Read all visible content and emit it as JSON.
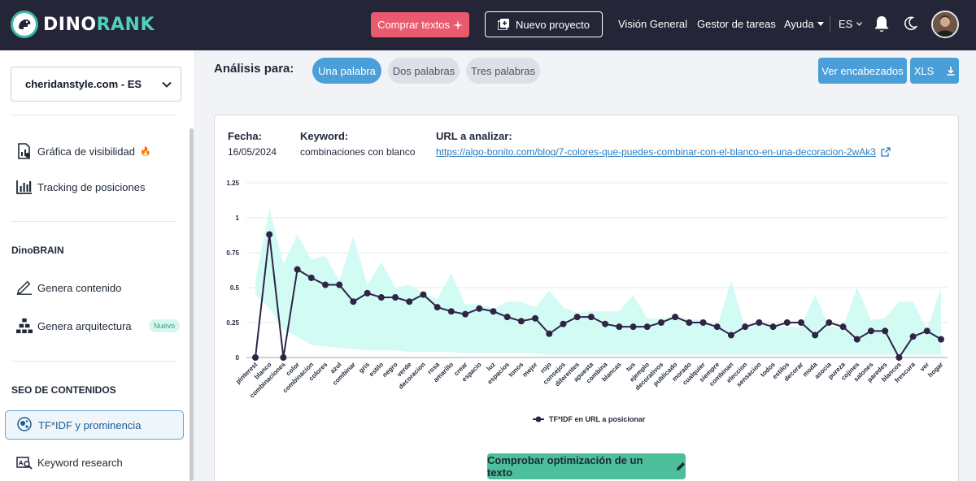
{
  "brand": {
    "name_part1": "DINO",
    "name_part2": "RANK",
    "color_primary": "#252538",
    "color_accent": "#4fd1b8"
  },
  "header": {
    "comprar_label": "Comprar textos",
    "nuevo_label": "Nuevo proyecto",
    "nav": [
      "Visión General",
      "Gestor de tareas",
      "Ayuda"
    ],
    "lang": "ES",
    "icons": [
      "bell-icon",
      "moon-icon",
      "avatar"
    ]
  },
  "sidebar": {
    "site": "cheridanstyle.com - ES",
    "items_top": [
      {
        "label": "Gráfica de visibilidad",
        "icon": "document-chart-icon",
        "emoji": "🔥"
      },
      {
        "label": "Tracking de posiciones",
        "icon": "bar-chart-icon"
      }
    ],
    "section_brain": "DinoBRAIN",
    "items_brain": [
      {
        "label": "Genera contenido",
        "icon": "pen-lines-icon"
      },
      {
        "label": "Genera arquitectura",
        "icon": "hierarchy-icon",
        "badge": "Nuevo"
      }
    ],
    "section_seo": "SEO DE CONTENIDOS",
    "items_seo": [
      {
        "label": "TF*IDF y prominencia",
        "icon": "bubbles-icon",
        "active": true
      },
      {
        "label": "Keyword research",
        "icon": "keyword-search-icon"
      }
    ]
  },
  "main": {
    "analisis_label": "Análisis para:",
    "tabs": [
      "Una palabra",
      "Dos palabras",
      "Tres palabras"
    ],
    "active_tab": "Una palabra",
    "btn_encabezados": "Ver encabezados",
    "btn_xls": "XLS",
    "fecha_label": "Fecha:",
    "fecha_value": "16/05/2024",
    "keyword_label": "Keyword:",
    "keyword_value": "combinaciones con blanco",
    "url_label": "URL a analizar:",
    "url_value": "https://algo-bonito.com/blog/7-colores-que-puedes-combinar-con-el-blanco-en-una-decoracion-2wAk3",
    "btn_comprobar": "Comprobar optimización de un texto"
  },
  "chart_data": {
    "type": "line",
    "ylim": [
      0,
      1.25
    ],
    "yticks": [
      "0",
      "0.25",
      "0.5",
      "0.75",
      "1",
      "1.25"
    ],
    "categories": [
      "pinterest",
      "blanco",
      "combinaciones",
      "color",
      "combinacion",
      "colores",
      "azul",
      "combinar",
      "gris",
      "estilo",
      "negro",
      "verde",
      "decoracion",
      "rosa",
      "amarillo",
      "crear",
      "espacio",
      "luz",
      "espacios",
      "tonos",
      "mejor",
      "rojo",
      "consejos",
      "diferentes",
      "apuesta",
      "combina",
      "blancas",
      "tus",
      "ejemplo",
      "decorativos",
      "publicado",
      "morado",
      "cualquier",
      "siempre",
      "combinan",
      "eleccion",
      "sensacion",
      "todos",
      "estilos",
      "decorar",
      "moda",
      "asocia",
      "pureza",
      "cojines",
      "salones",
      "paredes",
      "blancos",
      "frescura",
      "ver",
      "hogar"
    ],
    "series": [
      {
        "name": "TF*IDF en URL a posicionar",
        "color": "#2e2446",
        "values": [
          0,
          0.88,
          0,
          0.63,
          0.57,
          0.52,
          0.52,
          0.4,
          0.46,
          0.43,
          0.43,
          0.4,
          0.45,
          0.36,
          0.33,
          0.31,
          0.35,
          0.33,
          0.29,
          0.26,
          0.28,
          0.17,
          0.24,
          0.29,
          0.29,
          0.24,
          0.22,
          0.22,
          0.22,
          0.25,
          0.29,
          0.25,
          0.25,
          0.22,
          0.16,
          0.22,
          0.25,
          0.22,
          0.25,
          0.25,
          0.16,
          0.25,
          0.22,
          0.13,
          0.19,
          0.19,
          0,
          0.15,
          0.19,
          0.13
        ]
      }
    ],
    "band": {
      "color": "#d2fbf4",
      "upper": [
        0.55,
        1.07,
        0.67,
        0.88,
        0.7,
        0.73,
        0.55,
        0.87,
        0.52,
        0.68,
        0.5,
        0.52,
        0.46,
        0.42,
        0.6,
        0.38,
        0.38,
        0.35,
        0.4,
        0.4,
        0.36,
        0.48,
        0.36,
        0.32,
        0.33,
        0.33,
        0.33,
        0.45,
        0.28,
        0.28,
        0.3,
        0.27,
        0.27,
        0.22,
        0.55,
        0.22,
        0.24,
        0.22,
        0.22,
        0.22,
        0.45,
        0.22,
        0.22,
        0.5,
        0.27,
        0.28,
        0.4,
        0.4,
        0.2,
        0.5
      ],
      "lower": [
        0.45,
        0.35,
        0.2,
        0.15,
        0.09,
        0.08,
        0.07,
        0.06,
        0.05,
        0.05,
        0.05,
        0.04,
        0.04,
        0.04,
        0.04,
        0.03,
        0.03,
        0.03,
        0.03,
        0.03,
        0.03,
        0.02,
        0.02,
        0.02,
        0.02,
        0.02,
        0.02,
        0.02,
        0.02,
        0.02,
        0.02,
        0.02,
        0.02,
        0.02,
        0.02,
        0.02,
        0.02,
        0.02,
        0.02,
        0.02,
        0.02,
        0.02,
        0.02,
        0.02,
        0.02,
        0.02,
        0.02,
        0.02,
        0.02,
        0.02
      ]
    },
    "legend_position": "bottom",
    "grid": true
  }
}
